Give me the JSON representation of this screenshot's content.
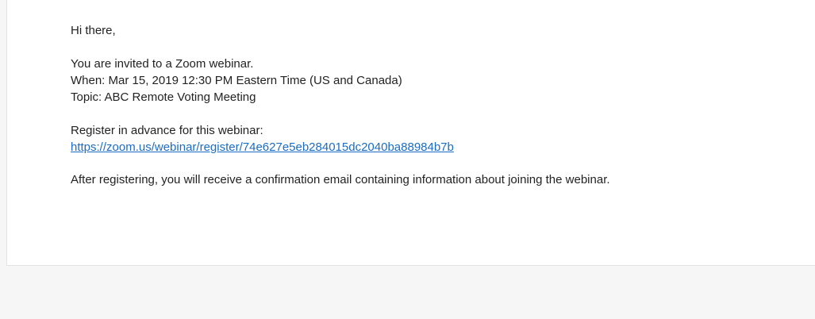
{
  "email": {
    "greeting": "Hi there,",
    "invite_line": "You are invited to a Zoom webinar.",
    "when_line": "When: Mar 15, 2019 12:30 PM Eastern Time (US and Canada)",
    "topic_line": "Topic: ABC Remote Voting Meeting",
    "register_prompt": "Register in advance for this webinar:",
    "register_url": "https://zoom.us/webinar/register/74e627e5eb284015dc2040ba88984b7b",
    "closing_line": "After registering, you will receive a confirmation email containing information about joining the webinar."
  },
  "colors": {
    "link": "#1a6cc4",
    "text": "#222222",
    "background": "#f6f6f6",
    "card": "#ffffff"
  }
}
